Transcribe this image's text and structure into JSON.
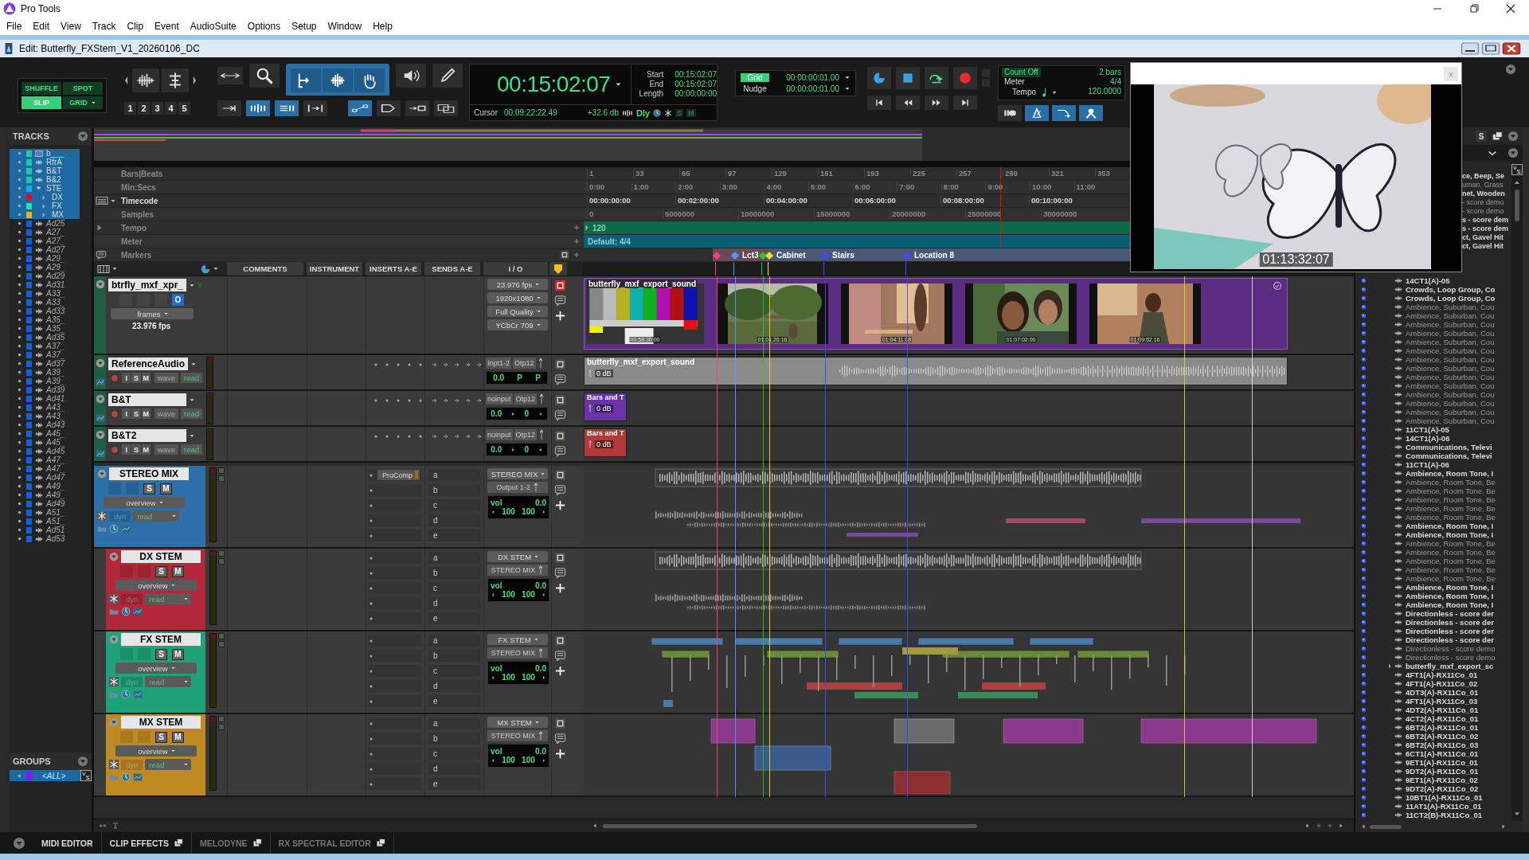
{
  "app": {
    "title": "Pro Tools"
  },
  "menu": [
    "File",
    "Edit",
    "View",
    "Track",
    "Clip",
    "Event",
    "AudioSuite",
    "Options",
    "Setup",
    "Window",
    "Help"
  ],
  "edit_window": {
    "title": "Edit: Butterfly_FXStem_V1_20260106_DC"
  },
  "toolbar": {
    "edit_modes": [
      {
        "label": "SHUFFLE",
        "selected": false
      },
      {
        "label": "SPOT",
        "selected": false
      },
      {
        "label": "SLIP",
        "selected": true
      },
      {
        "label": "GRID",
        "selected": false
      }
    ],
    "zoom_presets": [
      "1",
      "2",
      "3",
      "4",
      "5"
    ],
    "tools": [
      {
        "kind": "zoom",
        "selected": false
      },
      {
        "kind": "trim",
        "selected": true
      },
      {
        "kind": "select",
        "selected": true
      },
      {
        "kind": "grab",
        "selected": true
      },
      {
        "kind": "scrub",
        "selected": false
      },
      {
        "kind": "pencil",
        "selected": false
      }
    ],
    "counter": {
      "main": "00:15:02:07",
      "start_label": "Start",
      "start": "00:15:02:07",
      "end_label": "End",
      "end": "00:15:02:07",
      "length_label": "Length",
      "length": "00:00:00:00",
      "cursor_label": "Cursor",
      "cursor": "00:09:22:22.49",
      "level": "+32.6 db",
      "dly": "Dly",
      "solo": "S",
      "mute": "M"
    },
    "grid": {
      "label": "Grid",
      "value": "00:00:00:01.00"
    },
    "nudge": {
      "label": "Nudge",
      "value": "00:00:00:01.00"
    },
    "count_off": {
      "label": "Count Off",
      "value": "2 bars"
    },
    "meter": {
      "label": "Meter",
      "value": "4/4"
    },
    "tempo": {
      "label": "Tempo",
      "value": "120.0000"
    }
  },
  "video_window": {
    "timecode": "01:13:32:07",
    "close": "x"
  },
  "tracks_panel": {
    "title": "TRACKS",
    "tracks": [
      {
        "name": "b___",
        "color": "#1ec8a0",
        "selected": true,
        "inactive": false,
        "kind": "video"
      },
      {
        "name": "RfrA",
        "color": "#1ec8a0",
        "selected": true,
        "inactive": false,
        "kind": "audio"
      },
      {
        "name": "B&T",
        "color": "#1ec8a0",
        "selected": true,
        "inactive": false,
        "kind": "audio"
      },
      {
        "name": "B&2",
        "color": "#1ec8a0",
        "selected": true,
        "inactive": false,
        "kind": "audio"
      },
      {
        "name": "STE",
        "color": "#10a8f0",
        "selected": true,
        "inactive": false,
        "kind": "folder",
        "children": [
          {
            "name": "DX",
            "color": "#e01010",
            "selected": true,
            "inactive": false,
            "kind": "aux"
          },
          {
            "name": "FX",
            "color": "#20e0b0",
            "selected": true,
            "inactive": false,
            "kind": "aux"
          },
          {
            "name": "MX",
            "color": "#f0b020",
            "selected": true,
            "inactive": false,
            "kind": "aux"
          }
        ]
      },
      {
        "name": "Ad25",
        "color": "#1060e0",
        "selected": false,
        "inactive": true,
        "kind": "audio"
      },
      {
        "name": "A27_",
        "color": "#1060e0",
        "selected": false,
        "inactive": true,
        "kind": "audio"
      },
      {
        "name": "A27_",
        "color": "#1060e0",
        "selected": false,
        "inactive": true,
        "kind": "audio"
      },
      {
        "name": "Ad27",
        "color": "#1060e0",
        "selected": false,
        "inactive": true,
        "kind": "audio"
      },
      {
        "name": "A29_",
        "color": "#1060e0",
        "selected": false,
        "inactive": true,
        "kind": "audio"
      },
      {
        "name": "A29_",
        "color": "#1060e0",
        "selected": false,
        "inactive": true,
        "kind": "audio"
      },
      {
        "name": "Ad29",
        "color": "#1060e0",
        "selected": false,
        "inactive": true,
        "kind": "audio"
      },
      {
        "name": "Ad31",
        "color": "#1060e0",
        "selected": false,
        "inactive": true,
        "kind": "audio"
      },
      {
        "name": "A33_",
        "color": "#1060e0",
        "selected": false,
        "inactive": true,
        "kind": "audio"
      },
      {
        "name": "A33_",
        "color": "#1060e0",
        "selected": false,
        "inactive": true,
        "kind": "audio"
      },
      {
        "name": "Ad33",
        "color": "#1060e0",
        "selected": false,
        "inactive": true,
        "kind": "audio"
      },
      {
        "name": "A35_",
        "color": "#1060e0",
        "selected": false,
        "inactive": true,
        "kind": "audio"
      },
      {
        "name": "A35_",
        "color": "#1060e0",
        "selected": false,
        "inactive": true,
        "kind": "audio"
      },
      {
        "name": "Ad35",
        "color": "#1060e0",
        "selected": false,
        "inactive": true,
        "kind": "audio"
      },
      {
        "name": "A37_",
        "color": "#1060e0",
        "selected": false,
        "inactive": true,
        "kind": "audio"
      },
      {
        "name": "A37_",
        "color": "#1060e0",
        "selected": false,
        "inactive": true,
        "kind": "audio"
      },
      {
        "name": "Ad37",
        "color": "#1060e0",
        "selected": false,
        "inactive": true,
        "kind": "audio"
      },
      {
        "name": "A39_",
        "color": "#1060e0",
        "selected": false,
        "inactive": true,
        "kind": "audio"
      },
      {
        "name": "A39_",
        "color": "#1060e0",
        "selected": false,
        "inactive": true,
        "kind": "audio"
      },
      {
        "name": "Ad39",
        "color": "#1060e0",
        "selected": false,
        "inactive": true,
        "kind": "audio"
      },
      {
        "name": "Ad41",
        "color": "#1060e0",
        "selected": false,
        "inactive": true,
        "kind": "audio"
      },
      {
        "name": "A43_",
        "color": "#1060e0",
        "selected": false,
        "inactive": true,
        "kind": "audio"
      },
      {
        "name": "A43_",
        "color": "#1060e0",
        "selected": false,
        "inactive": true,
        "kind": "audio"
      },
      {
        "name": "Ad43",
        "color": "#1060e0",
        "selected": false,
        "inactive": true,
        "kind": "audio"
      },
      {
        "name": "A45_",
        "color": "#1060e0",
        "selected": false,
        "inactive": true,
        "kind": "audio"
      },
      {
        "name": "A45_",
        "color": "#1060e0",
        "selected": false,
        "inactive": true,
        "kind": "audio"
      },
      {
        "name": "Ad45",
        "color": "#1060e0",
        "selected": false,
        "inactive": true,
        "kind": "audio"
      },
      {
        "name": "A47_",
        "color": "#1060e0",
        "selected": false,
        "inactive": true,
        "kind": "audio"
      },
      {
        "name": "A47_",
        "color": "#1060e0",
        "selected": false,
        "inactive": true,
        "kind": "audio"
      },
      {
        "name": "Ad47",
        "color": "#1060e0",
        "selected": false,
        "inactive": true,
        "kind": "audio"
      },
      {
        "name": "A49_",
        "color": "#1060e0",
        "selected": false,
        "inactive": true,
        "kind": "audio"
      },
      {
        "name": "A49_",
        "color": "#1060e0",
        "selected": false,
        "inactive": true,
        "kind": "audio"
      },
      {
        "name": "Ad49",
        "color": "#1060e0",
        "selected": false,
        "inactive": true,
        "kind": "audio"
      },
      {
        "name": "A51_",
        "color": "#1060e0",
        "selected": false,
        "inactive": true,
        "kind": "audio"
      },
      {
        "name": "A51_",
        "color": "#1060e0",
        "selected": false,
        "inactive": true,
        "kind": "audio"
      },
      {
        "name": "Ad51",
        "color": "#1060e0",
        "selected": false,
        "inactive": true,
        "kind": "audio"
      },
      {
        "name": "Ad53",
        "color": "#1060e0",
        "selected": false,
        "inactive": true,
        "kind": "audio"
      }
    ]
  },
  "groups_panel": {
    "title": "GROUPS",
    "groups": [
      {
        "name": "<ALL>",
        "color": "#7a1cff",
        "selected": true
      }
    ]
  },
  "rulers": [
    {
      "kind": "ticks",
      "label": "Bars|Beats",
      "primary": false,
      "ticks": [
        "1",
        "33",
        "65",
        "97",
        "129",
        "161",
        "193",
        "225",
        "257",
        "289",
        "321",
        "353"
      ]
    },
    {
      "kind": "ticks",
      "label": "Min:Secs",
      "primary": false,
      "ticks": [
        "0:00",
        "1:00",
        "2:00",
        "3:00",
        "4:00",
        "5:00",
        "6:00",
        "7:00",
        "8:00",
        "9:00",
        "10:00",
        "11:00"
      ]
    },
    {
      "kind": "ticks",
      "label": "Timecode",
      "primary": true,
      "ticks": [
        "00:00:00:00",
        "00:02:00:00",
        "00:04:00:00",
        "00:06:00:00",
        "00:08:00:00",
        "00:10:00:00"
      ]
    },
    {
      "kind": "ticks",
      "label": "Samples",
      "primary": false,
      "ticks": [
        "0",
        "5000000",
        "10000000",
        "15000000",
        "20000000",
        "25000000",
        "30000000"
      ]
    },
    {
      "kind": "tempo",
      "label": "Tempo",
      "primary": false,
      "value": "120"
    },
    {
      "kind": "meter",
      "label": "Meter",
      "primary": false,
      "value": "Default: 4/4"
    },
    {
      "kind": "markers",
      "label": "Markers",
      "primary": false,
      "markers": [
        {
          "color": "#ff3c8c"
        },
        {
          "name": "Lct3",
          "color": "#4aa0ff"
        },
        {
          "color": "#22cc22"
        },
        {
          "name": "Cabinet",
          "color": "#f0e020"
        },
        {
          "name": "Stairs",
          "color": "#4646ff"
        },
        {
          "name": "Location 8",
          "color": "#4646ff"
        }
      ]
    }
  ],
  "columns": [
    "COMMENTS",
    "INSTRUMENT",
    "INSERTS A-E",
    "SENDS A-E",
    "I / O"
  ],
  "tracks": [
    {
      "kind": "video",
      "name": "btrfly_mxf_xpr_",
      "online": "O",
      "timebase": "frames",
      "rate": "23.976 fps",
      "io": [
        "23.976 fps",
        "1920x1080",
        "Full Quality",
        "YCbCr 709"
      ],
      "clip": {
        "name": "butterfly_mxf_export_sound",
        "frames": [
          "00:58:30:00",
          "01:01:20:16",
          "01:04:11:08",
          "01:07:02:00",
          "01:09:52:16"
        ]
      }
    },
    {
      "kind": "audio",
      "name": "ReferenceAudio",
      "buttons": [
        "I",
        "S",
        "M"
      ],
      "view": "wave",
      "automation": "read",
      "io": [
        "Inpt1-2",
        "Otp12"
      ],
      "vol": "0.0",
      "pan": [
        "P",
        "P"
      ],
      "clip": {
        "name": "butterfly_mxf_export_sound",
        "gain": "0 dB",
        "color": "#8a8a8a"
      }
    },
    {
      "kind": "audio",
      "name": "B&T",
      "buttons": [
        "I",
        "S",
        "M"
      ],
      "view": "wave",
      "automation": "read",
      "io": [
        "noinput",
        "Otp12"
      ],
      "vol": "0.0",
      "pan": [
        "0"
      ],
      "clip": {
        "name": "Bars and T",
        "gain": "0 dB",
        "color": "#6a34a8"
      }
    },
    {
      "kind": "audio",
      "name": "B&T2",
      "buttons": [
        "I",
        "S",
        "M"
      ],
      "view": "wave",
      "automation": "read",
      "io": [
        "noinput",
        "Otp12"
      ],
      "vol": "0.0",
      "pan": [
        "0"
      ],
      "clip": {
        "name": "Bars and T",
        "gain": "0 dB",
        "color": "#b03a3a"
      }
    },
    {
      "kind": "aux",
      "name": "STEREO MIX",
      "color": "#2d6fa8",
      "solo": "S",
      "mute": "M",
      "view": "overview",
      "dyn": "dyn",
      "automation": "read",
      "inserts": [
        "ProComp"
      ],
      "sends": [
        "a",
        "b",
        "c",
        "d",
        "e"
      ],
      "io": [
        "STEREO MIX",
        "Output 1-2"
      ],
      "vol_label": "vol",
      "vol": "0.0",
      "pan": [
        "100",
        "100"
      ],
      "children": [
        {
          "kind": "aux",
          "name": "DX STEM",
          "color": "#b0283a",
          "solo": "S",
          "mute": "M",
          "view": "overview",
          "dyn": "dyn",
          "automation": "read",
          "sends": [
            "a",
            "b",
            "c",
            "d",
            "e"
          ],
          "io": [
            "DX STEM",
            "STEREO MIX"
          ],
          "vol_label": "vol",
          "vol": "0.0",
          "pan": [
            "100",
            "100"
          ]
        },
        {
          "kind": "aux",
          "name": "FX STEM",
          "color": "#1fa27a",
          "solo": "S",
          "mute": "M",
          "view": "overview",
          "dyn": "dyn",
          "automation": "read",
          "sends": [
            "a",
            "b",
            "c",
            "d",
            "e"
          ],
          "io": [
            "FX STEM",
            "STEREO MIX"
          ],
          "vol_label": "vol",
          "vol": "0.0",
          "pan": [
            "100",
            "100"
          ]
        },
        {
          "kind": "aux",
          "name": "MX STEM",
          "color": "#c08a22",
          "solo": "S",
          "mute": "M",
          "view": "overview",
          "dyn": "dyn",
          "automation": "read",
          "sends": [
            "a",
            "b",
            "c",
            "d",
            "e"
          ],
          "io": [
            "MX STEM",
            "STEREO MIX"
          ],
          "vol_label": "vol",
          "vol": "0.0",
          "pan": [
            "100",
            "100"
          ]
        }
      ]
    }
  ],
  "clip_list": {
    "sort_button": "S",
    "clips": [
      {
        "name": "ce, Beep, Se",
        "kind": "whole",
        "covered": true
      },
      {
        "name": "uman, Grass",
        "kind": "part",
        "covered": true
      },
      {
        "name": "net, Wooden",
        "kind": "whole",
        "covered": true
      },
      {
        "name": "- score demo",
        "kind": "part",
        "covered": true
      },
      {
        "name": "- score demo",
        "kind": "part",
        "covered": true
      },
      {
        "name": "s - score dem",
        "kind": "whole",
        "covered": true
      },
      {
        "name": "s - score dem",
        "kind": "whole",
        "covered": true
      },
      {
        "name": "ct, Gavel Hit",
        "kind": "whole",
        "covered": true
      },
      {
        "name": "ct, Gavel Hit",
        "kind": "whole",
        "covered": true
      },
      {
        "name": "14CT1(A)-05",
        "kind": "whole",
        "covered": false
      },
      {
        "name": "Crowds, Loop Group, Co",
        "kind": "whole",
        "covered": false
      },
      {
        "name": "Crowds, Loop Group, Co",
        "kind": "whole",
        "covered": false
      },
      {
        "name": "Ambience, Suburban, Cou",
        "kind": "part",
        "covered": false
      },
      {
        "name": "Ambience, Suburban, Cou",
        "kind": "part",
        "covered": false
      },
      {
        "name": "Ambience, Suburban, Cou",
        "kind": "part",
        "covered": false
      },
      {
        "name": "Ambience, Suburban, Cou",
        "kind": "part",
        "covered": false
      },
      {
        "name": "Ambience, Suburban, Cou",
        "kind": "part",
        "covered": false
      },
      {
        "name": "Ambience, Suburban, Cou",
        "kind": "part",
        "covered": false
      },
      {
        "name": "Ambience, Suburban, Cou",
        "kind": "part",
        "covered": false
      },
      {
        "name": "Ambience, Suburban, Cou",
        "kind": "part",
        "covered": false
      },
      {
        "name": "Ambience, Suburban, Cou",
        "kind": "part",
        "covered": false
      },
      {
        "name": "Ambience, Suburban, Cou",
        "kind": "part",
        "covered": false
      },
      {
        "name": "Ambience, Suburban, Cou",
        "kind": "part",
        "covered": false
      },
      {
        "name": "Ambience, Suburban, Cou",
        "kind": "part",
        "covered": false
      },
      {
        "name": "Ambience, Suburban, Cou",
        "kind": "part",
        "covered": false
      },
      {
        "name": "Ambience, Suburban, Cou",
        "kind": "part",
        "covered": false
      },
      {
        "name": "11CT1(A)-05",
        "kind": "whole",
        "covered": false
      },
      {
        "name": "14CT1(A)-06",
        "kind": "whole",
        "covered": false
      },
      {
        "name": "Communications, Televi",
        "kind": "whole",
        "covered": false
      },
      {
        "name": "Communications, Televi",
        "kind": "whole",
        "covered": false
      },
      {
        "name": "11CT1(A)-06",
        "kind": "whole",
        "covered": false
      },
      {
        "name": "Ambience, Room Tone, I",
        "kind": "whole",
        "covered": false
      },
      {
        "name": "Ambience, Room Tone, Be",
        "kind": "part",
        "covered": false
      },
      {
        "name": "Ambience, Room Tone, Be",
        "kind": "part",
        "covered": false
      },
      {
        "name": "Ambience, Room Tone, Be",
        "kind": "part",
        "covered": false
      },
      {
        "name": "Ambience, Room Tone, Be",
        "kind": "part",
        "covered": false
      },
      {
        "name": "Ambience, Room Tone, Be",
        "kind": "part",
        "covered": false
      },
      {
        "name": "Ambience, Room Tone, I",
        "kind": "whole",
        "covered": false
      },
      {
        "name": "Ambience, Room Tone, I",
        "kind": "whole",
        "covered": false
      },
      {
        "name": "Ambience, Room Tone, Be",
        "kind": "part",
        "covered": false
      },
      {
        "name": "Ambience, Room Tone, Be",
        "kind": "part",
        "covered": false
      },
      {
        "name": "Ambience, Room Tone, Be",
        "kind": "part",
        "covered": false
      },
      {
        "name": "Ambience, Room Tone, Be",
        "kind": "part",
        "covered": false
      },
      {
        "name": "Ambience, Room Tone, Be",
        "kind": "part",
        "covered": false
      },
      {
        "name": "Ambience, Room Tone, I",
        "kind": "whole",
        "covered": false
      },
      {
        "name": "Ambience, Room Tone, I",
        "kind": "whole",
        "covered": false
      },
      {
        "name": "Ambience, Room Tone, I",
        "kind": "whole",
        "covered": false
      },
      {
        "name": "Directionless - score der",
        "kind": "whole",
        "covered": false
      },
      {
        "name": "Directionless - score der",
        "kind": "whole",
        "covered": false
      },
      {
        "name": "Directionless - score der",
        "kind": "whole",
        "covered": false
      },
      {
        "name": "Directionless - score der",
        "kind": "whole",
        "covered": false
      },
      {
        "name": "Directionless - score demo",
        "kind": "part",
        "covered": false
      },
      {
        "name": "Directionless - score demo",
        "kind": "part",
        "covered": false
      },
      {
        "name": "butterfly_mxf_export_sc",
        "kind": "group",
        "covered": false
      },
      {
        "name": "4FT1(A)-RX11Co_01",
        "kind": "whole",
        "covered": false
      },
      {
        "name": "4FT1(A)-RX11Co_02",
        "kind": "whole",
        "covered": false
      },
      {
        "name": "4DT3(A)-RX11Co_01",
        "kind": "whole",
        "covered": false
      },
      {
        "name": "4FT1(A)-RX11Co_03",
        "kind": "whole",
        "covered": false
      },
      {
        "name": "4DT2(A)-RX11Co_01",
        "kind": "whole",
        "covered": false
      },
      {
        "name": "4CT2(A)-RX11Co_01",
        "kind": "whole",
        "covered": false
      },
      {
        "name": "6BT2(A)-RX11Co_01",
        "kind": "whole",
        "covered": false
      },
      {
        "name": "6BT2(A)-RX11Co_02",
        "kind": "whole",
        "covered": false
      },
      {
        "name": "6BT2(A)-RX11Co_03",
        "kind": "whole",
        "covered": false
      },
      {
        "name": "6CT1(A)-RX11Co_01",
        "kind": "whole",
        "covered": false
      },
      {
        "name": "9ET1(A)-RX11Co_01",
        "kind": "whole",
        "covered": false
      },
      {
        "name": "9DT2(A)-RX11Co_01",
        "kind": "whole",
        "covered": false
      },
      {
        "name": "9ET1(A)-RX11Co_02",
        "kind": "whole",
        "covered": false
      },
      {
        "name": "9DT2(A)-RX11Co_02",
        "kind": "whole",
        "covered": false
      },
      {
        "name": "10BT1(A)-RX11Co_01",
        "kind": "whole",
        "covered": false
      },
      {
        "name": "11AT1(A)-RX11Co_01",
        "kind": "whole",
        "covered": false
      },
      {
        "name": "11CT2(B)-RX11Co_01",
        "kind": "whole",
        "covered": false
      }
    ]
  },
  "bottom_tabs": [
    {
      "label": "MIDI EDITOR",
      "disabled": false,
      "detachable": false
    },
    {
      "label": "CLIP EFFECTS",
      "disabled": false,
      "detachable": true
    },
    {
      "label": "MELODYNE",
      "disabled": true,
      "detachable": true
    },
    {
      "label": "RX SPECTRAL EDITOR",
      "disabled": true,
      "detachable": true
    }
  ]
}
